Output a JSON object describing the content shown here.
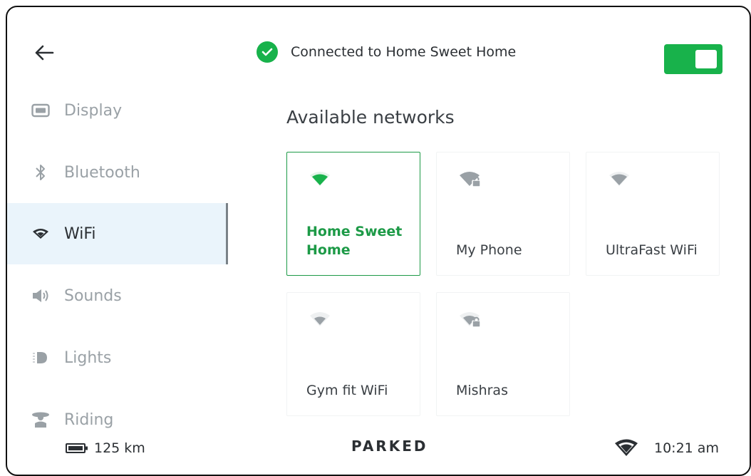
{
  "header": {
    "status_text": "Connected to Home Sweet Home",
    "wifi_toggle_on": true
  },
  "sidebar": {
    "items": [
      {
        "label": "Display",
        "icon": "display-icon"
      },
      {
        "label": "Bluetooth",
        "icon": "bluetooth-icon"
      },
      {
        "label": "WiFi",
        "icon": "wifi-icon",
        "active": true
      },
      {
        "label": "Sounds",
        "icon": "speaker-icon"
      },
      {
        "label": "Lights",
        "icon": "headlight-icon"
      },
      {
        "label": "Riding",
        "icon": "rider-icon"
      }
    ]
  },
  "main": {
    "section_title": "Available networks",
    "networks": [
      {
        "name": "Home Sweet Home",
        "selected": true,
        "locked": false
      },
      {
        "name": "My Phone",
        "selected": false,
        "locked": true
      },
      {
        "name": "UltraFast WiFi",
        "selected": false,
        "locked": false
      },
      {
        "name": "Gym fit WiFi",
        "selected": false,
        "locked": false
      },
      {
        "name": "Mishras",
        "selected": false,
        "locked": true
      }
    ]
  },
  "footer": {
    "range": "125 km",
    "ride_state": "PARKED",
    "time": "10:21 am"
  },
  "colors": {
    "accent_green": "#18b24b",
    "selected_text_green": "#1d9a47",
    "active_bg": "#eaf4fb"
  }
}
